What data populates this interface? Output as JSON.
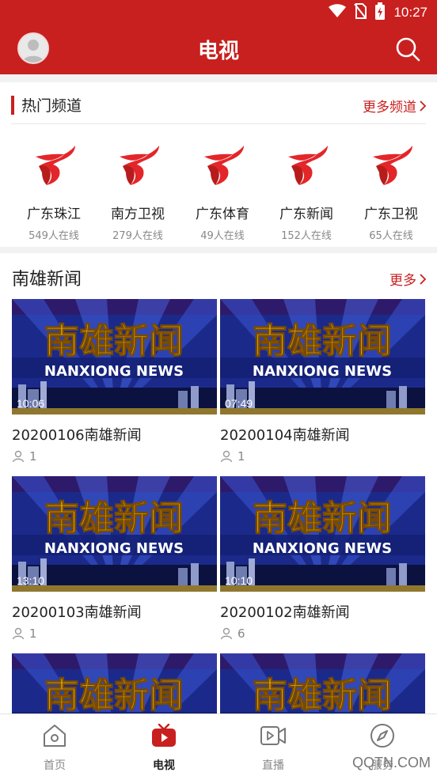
{
  "status_bar": {
    "time": "10:27"
  },
  "app_bar": {
    "title": "电视"
  },
  "hot_channels": {
    "title": "热门频道",
    "more_label": "更多频道",
    "items": [
      {
        "name": "广东珠江",
        "online": "549人在线"
      },
      {
        "name": "南方卫视",
        "online": "279人在线"
      },
      {
        "name": "广东体育",
        "online": "49人在线"
      },
      {
        "name": "广东新闻",
        "online": "152人在线"
      },
      {
        "name": "广东卫视",
        "online": "65人在线"
      }
    ]
  },
  "news_section": {
    "title": "南雄新闻",
    "more_label": "更多",
    "thumb_text_cn": "南雄新闻",
    "thumb_text_en": "NANXIONG NEWS",
    "videos": [
      {
        "duration": "10:06",
        "title": "20200106南雄新闻",
        "views": "1"
      },
      {
        "duration": "07:49",
        "title": "20200104南雄新闻",
        "views": "1"
      },
      {
        "duration": "13:10",
        "title": "20200103南雄新闻",
        "views": "1"
      },
      {
        "duration": "10:10",
        "title": "20200102南雄新闻",
        "views": "6"
      }
    ]
  },
  "tab_bar": {
    "tabs": [
      {
        "label": "首页",
        "icon": "home-icon"
      },
      {
        "label": "电视",
        "icon": "tv-icon"
      },
      {
        "label": "直播",
        "icon": "live-video-icon"
      },
      {
        "label": "服务",
        "icon": "compass-icon"
      }
    ]
  },
  "watermark": "QQTN.COM",
  "colors": {
    "brand_red": "#c8201f",
    "text_dark": "#222222",
    "text_gray": "#888888"
  }
}
